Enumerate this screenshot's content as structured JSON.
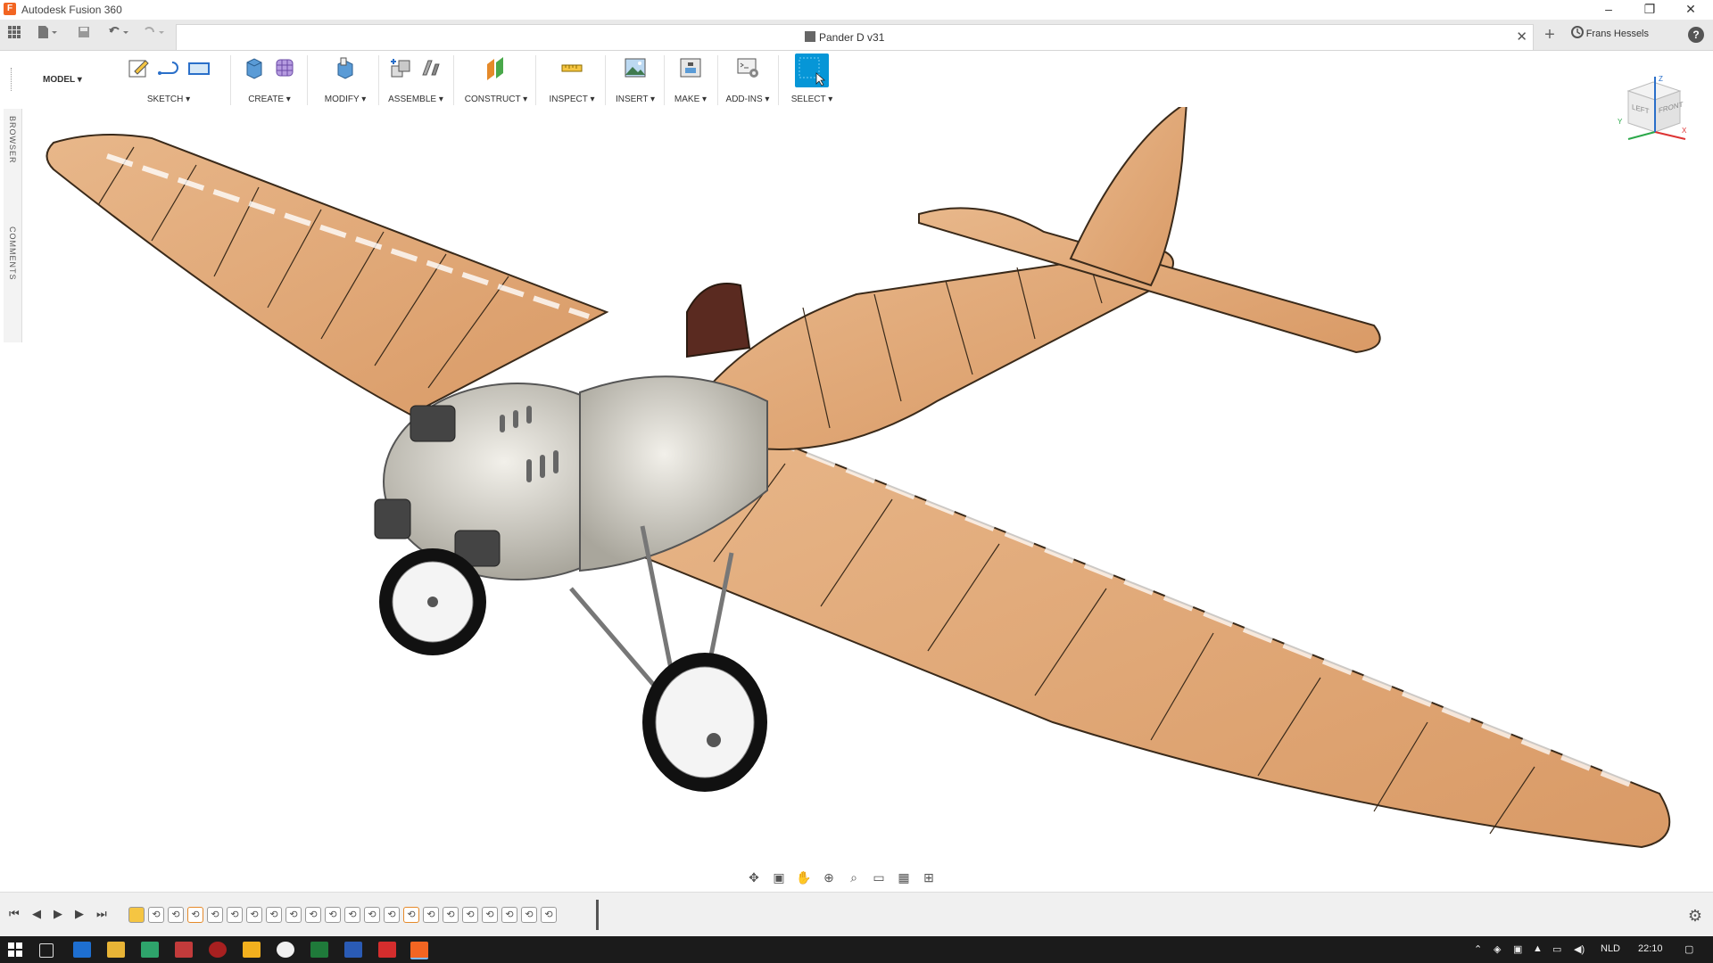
{
  "window": {
    "title": "Autodesk Fusion 360",
    "app_icon": "F",
    "controls": [
      "–",
      "❐",
      "✕"
    ]
  },
  "appbar": {
    "document_title": "Pander D v31",
    "user_name": "Frans Hessels",
    "help_icon": "?",
    "new_tab_icon": "+",
    "close_tab_icon": "✕"
  },
  "toolbar": {
    "workspace": "MODEL ▾",
    "groups": [
      {
        "label": "SKETCH ▾"
      },
      {
        "label": "CREATE ▾"
      },
      {
        "label": "MODIFY ▾"
      },
      {
        "label": "ASSEMBLE ▾"
      },
      {
        "label": "CONSTRUCT ▾"
      },
      {
        "label": "INSPECT ▾"
      },
      {
        "label": "INSERT ▾"
      },
      {
        "label": "MAKE ▾"
      },
      {
        "label": "ADD-INS ▾"
      },
      {
        "label": "SELECT ▾"
      }
    ]
  },
  "sidebar": {
    "browser": "BROWSER",
    "comments": "COMMENTS"
  },
  "viewcube": {
    "left": "LEFT",
    "front": "FRONT",
    "x_axis": "X",
    "y_axis": "Y",
    "z_axis": "Z"
  },
  "taskbar": {
    "language": "NLD",
    "time": "22:10"
  },
  "colors": {
    "accent": "#0696d7",
    "wood": "#e2ab7c",
    "fuselage_metal": "#d9d6cc",
    "taskbar": "#1b1b1b"
  }
}
